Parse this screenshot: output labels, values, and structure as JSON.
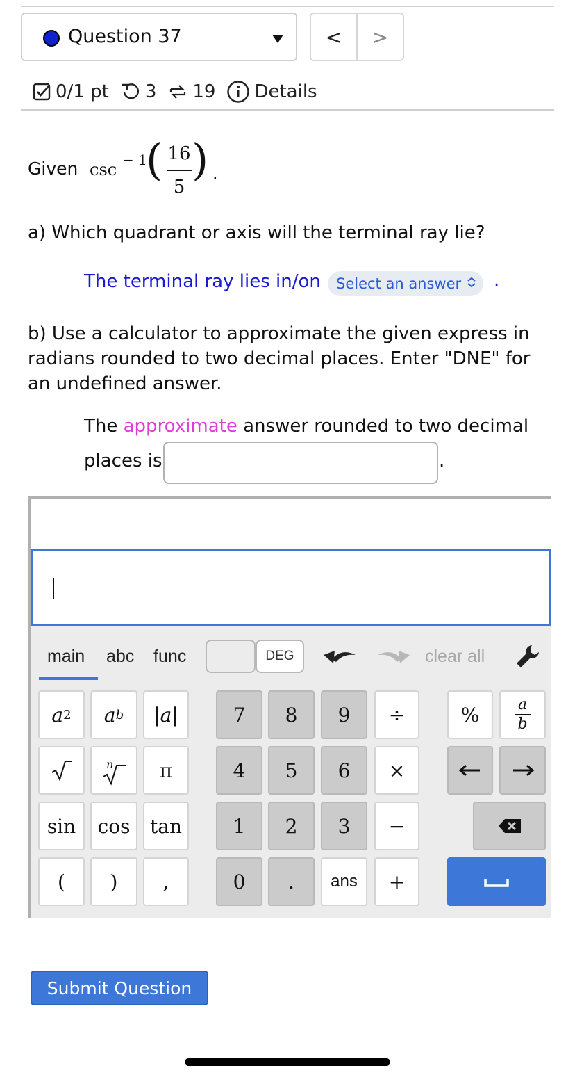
{
  "header": {
    "question_label": "Question 37",
    "prev": "<",
    "next": ">"
  },
  "meta": {
    "score": "0/1 pt",
    "retries": "3",
    "attempts": "19",
    "details": "Details"
  },
  "problem": {
    "given_label": "Given",
    "func": "csc",
    "exponent": "− 1",
    "numerator": "16",
    "denominator": "5",
    "period": ".",
    "part_a": "a) Which quadrant or axis will the terminal ray lie?",
    "ray_text": "The terminal ray lies in/on",
    "select_placeholder": "Select an answer",
    "part_b": "b) Use a calculator to approximate the given express in radians rounded to two decimal places. Enter \"DNE\" for an undefined answer.",
    "answer_prefix": "The",
    "answer_highlight": "approximate",
    "answer_rest": "answer rounded to two decimal",
    "answer_line2": "places is",
    "answer_value": ""
  },
  "keyboard": {
    "tabs": [
      "main",
      "abc",
      "func"
    ],
    "active_tab": "main",
    "angle_mode": "DEG",
    "clear_all": "clear all",
    "keys": {
      "abs": "|a|",
      "pi": "π",
      "sin": "sin",
      "cos": "cos",
      "tan": "tan",
      "lparen": "(",
      "rparen": ")",
      "comma": ",",
      "d7": "7",
      "d8": "8",
      "d9": "9",
      "d4": "4",
      "d5": "5",
      "d6": "6",
      "d1": "1",
      "d2": "2",
      "d3": "3",
      "d0": "0",
      "dot": ".",
      "ans": "ans",
      "divide": "÷",
      "times": "×",
      "minus": "−",
      "plus": "+",
      "percent": "%"
    }
  },
  "submit_label": "Submit Question"
}
